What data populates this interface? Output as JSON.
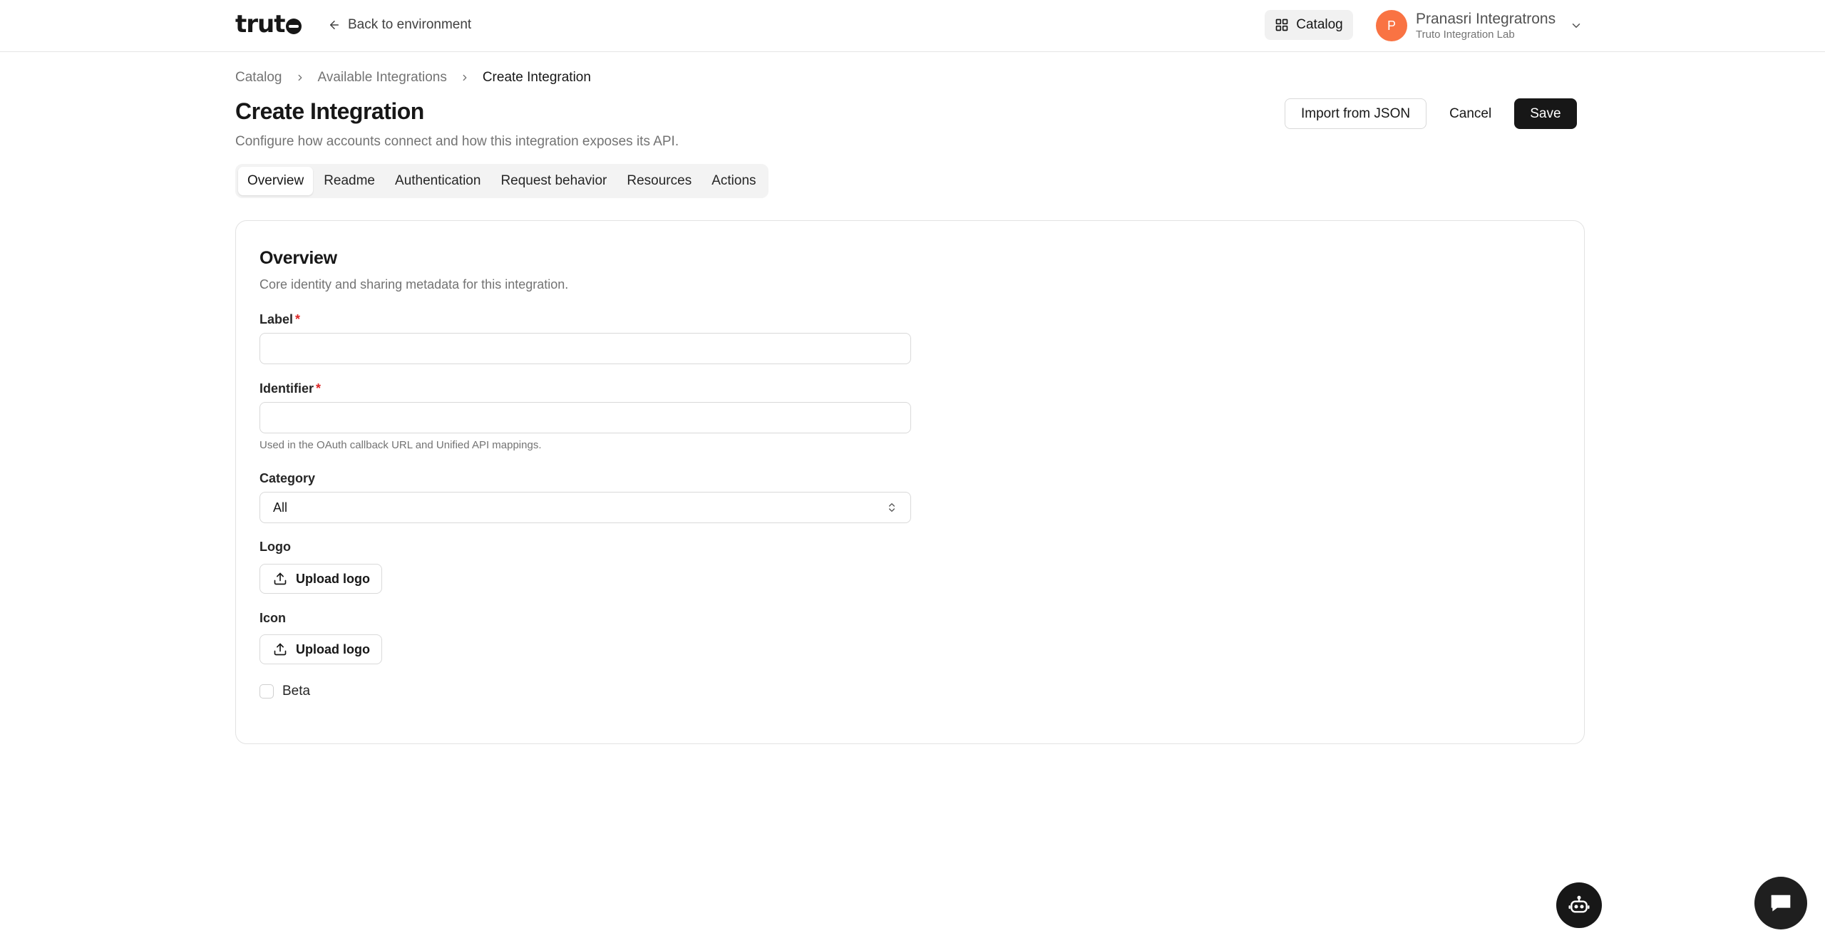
{
  "colors": {
    "accent": "#171717",
    "avatar_bg": "#f97343",
    "required": "#dc2626",
    "muted_text": "#737373"
  },
  "topbar": {
    "logo_text": "truto",
    "back_label": "Back to environment",
    "catalog_label": "Catalog",
    "account": {
      "avatar_initial": "P",
      "name": "Pranasri Integratrons",
      "org": "Truto Integration Lab"
    }
  },
  "breadcrumb": {
    "items": [
      "Catalog",
      "Available Integrations",
      "Create Integration"
    ]
  },
  "header": {
    "title": "Create Integration",
    "subtitle": "Configure how accounts connect and how this integration exposes its API.",
    "import_label": "Import from JSON",
    "cancel_label": "Cancel",
    "save_label": "Save"
  },
  "tabs": [
    {
      "label": "Overview",
      "active": true
    },
    {
      "label": "Readme",
      "active": false
    },
    {
      "label": "Authentication",
      "active": false
    },
    {
      "label": "Request behavior",
      "active": false
    },
    {
      "label": "Resources",
      "active": false
    },
    {
      "label": "Actions",
      "active": false
    }
  ],
  "overview": {
    "title": "Overview",
    "subtitle": "Core identity and sharing metadata for this integration.",
    "label_field": {
      "label": "Label",
      "required_mark": "*",
      "value": ""
    },
    "identifier_field": {
      "label": "Identifier",
      "required_mark": "*",
      "value": "",
      "helper": "Used in the OAuth callback URL and Unified API mappings."
    },
    "category_field": {
      "label": "Category",
      "selected": "All"
    },
    "logo_field": {
      "label": "Logo",
      "button_label": "Upload logo"
    },
    "icon_field": {
      "label": "Icon",
      "button_label": "Upload logo"
    },
    "beta": {
      "label": "Beta",
      "checked": false
    }
  },
  "icons": {
    "back": "arrow-left-icon",
    "catalog": "grid-icon",
    "account_chevron": "chevron-down-icon",
    "breadcrumb_sep": "chevron-right-icon",
    "select": "chevrons-up-down-icon",
    "upload": "upload-icon",
    "bot": "bot-icon",
    "chat": "chat-icon"
  }
}
